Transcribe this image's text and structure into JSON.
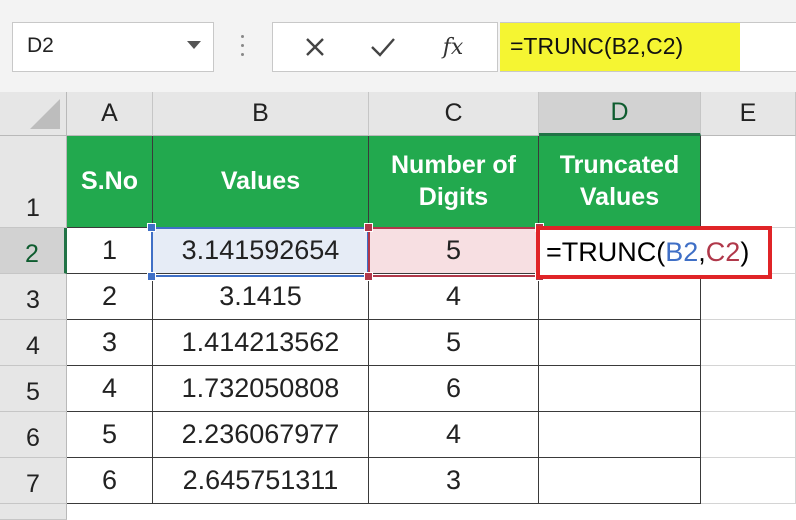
{
  "name_box": {
    "value": "D2"
  },
  "formula_bar": {
    "formula": "=TRUNC(B2,C2)",
    "fx_label": "fx"
  },
  "columns": [
    "A",
    "B",
    "C",
    "D",
    "E"
  ],
  "rows": [
    "1",
    "2",
    "3",
    "4",
    "5",
    "6",
    "7"
  ],
  "table": {
    "headers": [
      "S.No",
      "Values",
      "Number of Digits",
      "Truncated Values"
    ],
    "data": [
      {
        "sno": "1",
        "value": "3.141592654",
        "digits": "5",
        "truncated": ""
      },
      {
        "sno": "2",
        "value": "3.1415",
        "digits": "4",
        "truncated": ""
      },
      {
        "sno": "3",
        "value": "1.414213562",
        "digits": "5",
        "truncated": ""
      },
      {
        "sno": "4",
        "value": "1.732050808",
        "digits": "6",
        "truncated": ""
      },
      {
        "sno": "5",
        "value": "2.236067977",
        "digits": "4",
        "truncated": ""
      },
      {
        "sno": "6",
        "value": "2.645751311",
        "digits": "3",
        "truncated": ""
      }
    ]
  },
  "edit_cell": {
    "prefix": "=TRUNC(",
    "ref1": "B2",
    "sep": ",",
    "ref2": "C2",
    "suffix": ")"
  },
  "colors": {
    "header_green": "#22a94e",
    "edit_border": "#e02427",
    "formula_highlight": "#f5f532",
    "ref_blue": "#3f6fc6",
    "ref_red": "#b0384a"
  }
}
